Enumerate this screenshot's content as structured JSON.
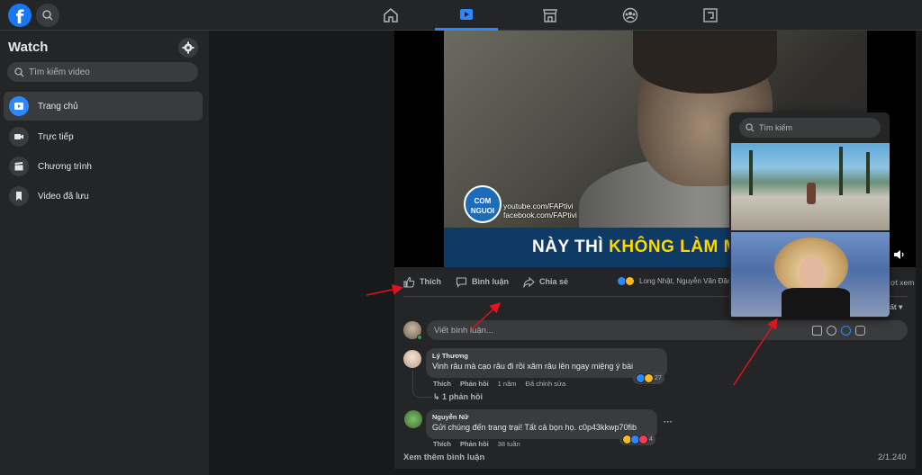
{
  "topbar": {
    "logo_letter": "f",
    "nav_tabs": [
      {
        "icon": "home-icon",
        "active": false
      },
      {
        "icon": "watch-icon",
        "active": true
      },
      {
        "icon": "marketplace-icon",
        "active": false
      },
      {
        "icon": "groups-icon",
        "active": false
      },
      {
        "icon": "gaming-icon",
        "active": false
      }
    ]
  },
  "sidebar": {
    "title": "Watch",
    "search_placeholder": "Tìm kiếm video",
    "items": [
      {
        "label": "Trang chủ",
        "icon": "play-icon",
        "active": true
      },
      {
        "label": "Trực tiếp",
        "icon": "live-camera-icon",
        "active": false
      },
      {
        "label": "Chương trình",
        "icon": "clapperboard-icon",
        "active": false
      },
      {
        "label": "Video đã lưu",
        "icon": "bookmark-icon",
        "active": false
      }
    ]
  },
  "video": {
    "channel_logo_text": "COM NGUOI",
    "channel_line1": "youtube.com/FAPtivi",
    "channel_line2": "facebook.com/FAPtivi",
    "subtitle_white": "NÀY THÌ",
    "subtitle_yellow": "KHÔNG LÀM MÀ ĐÒI"
  },
  "actions": {
    "like": "Thích",
    "comment": "Bình luận",
    "share": "Chia sẻ",
    "reaction_names": "Long Nhật, Nguyễn Văn Đăng",
    "views_suffix": "ợt xem",
    "sort_suffix": "uất"
  },
  "comment_box": {
    "placeholder": "Viết bình luận..."
  },
  "comments": [
    {
      "name": "Lý Thương",
      "text": "Vinh râu mà cạo râu đi rồi xăm râu lên ngay miệng ý bài",
      "like": "Thích",
      "reply": "Phản hồi",
      "time": "1 năm",
      "edited": "Đã chỉnh sửa",
      "reaction_count": "27",
      "replies_label": "↳ 1 phản hồi"
    },
    {
      "name": "Nguyễn Nữ",
      "text": "Gửi chúng đến trang trại! Tất cả bọn họ. c0p43kkwp70fib",
      "like": "Thích",
      "reply": "Phản hồi",
      "time": "38 tuần",
      "reaction_count": "4",
      "more": "···"
    }
  ],
  "footer": {
    "see_more": "Xem thêm bình luận",
    "count": "2/1.240"
  },
  "gif_picker": {
    "search_placeholder": "Tìm kiếm"
  },
  "colors": {
    "accent": "#2d88ff",
    "brand": "#1877f2",
    "annotation_arrow": "#e0141e",
    "subtitle_yellow": "#ffd800"
  }
}
